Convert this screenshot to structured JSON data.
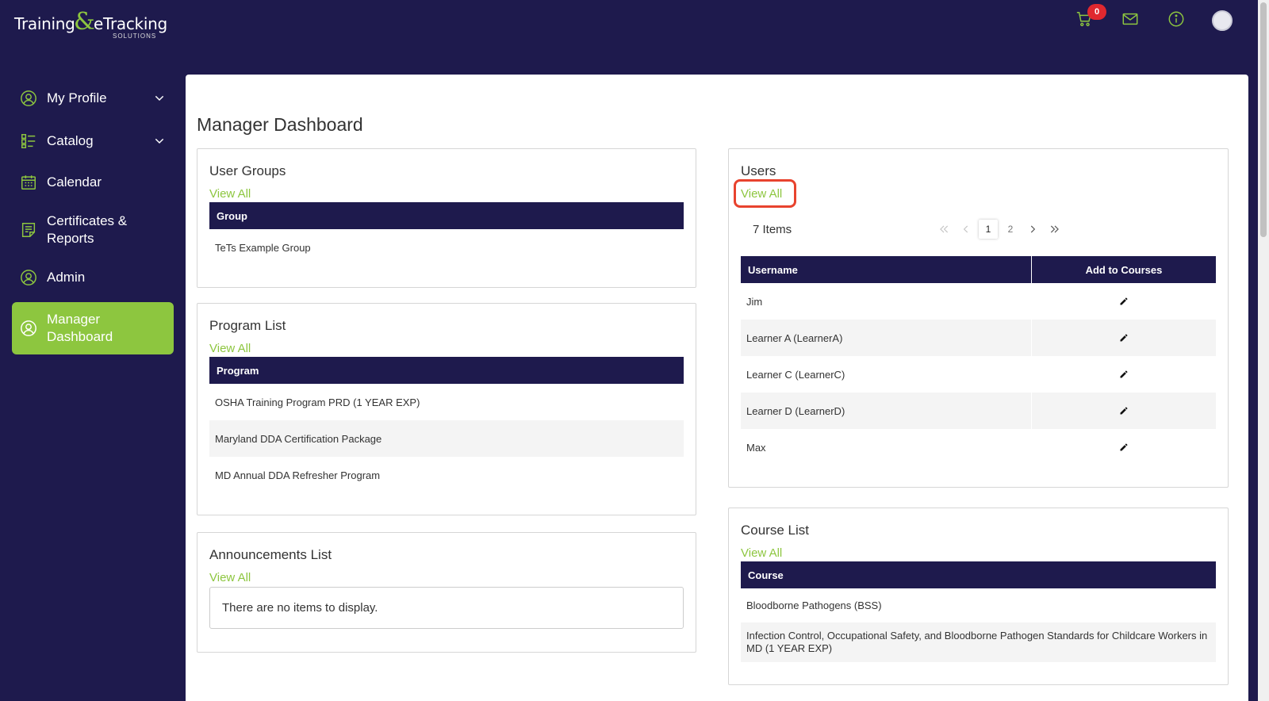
{
  "app": {
    "logo_word1": "Training",
    "logo_amp": "&",
    "logo_word2": "eTracking",
    "logo_sub": "SOLUTIONS"
  },
  "header": {
    "cart_count": "0",
    "icons": [
      "cart-icon",
      "mail-icon",
      "info-icon",
      "avatar"
    ]
  },
  "sidebar": {
    "items": [
      {
        "label": "My Profile",
        "icon": "user-circle-icon",
        "expandable": true
      },
      {
        "label": "Catalog",
        "icon": "list-icon",
        "expandable": true
      },
      {
        "label": "Calendar",
        "icon": "calendar-icon",
        "expandable": false
      },
      {
        "label": "Certificates &",
        "label2": "Reports",
        "icon": "report-icon",
        "expandable": false
      },
      {
        "label": "Admin",
        "icon": "user-circle-icon",
        "expandable": false
      },
      {
        "label": "Manager",
        "label2": "Dashboard",
        "icon": "user-circle-icon",
        "expandable": false,
        "active": true
      }
    ]
  },
  "main": {
    "title": "Manager Dashboard",
    "user_groups": {
      "title": "User Groups",
      "view_all": "View All",
      "header": "Group",
      "rows": [
        "TeTs Example Group"
      ]
    },
    "program_list": {
      "title": "Program List",
      "view_all": "View All",
      "header": "Program",
      "rows": [
        "OSHA Training Program PRD (1 YEAR EXP)",
        "Maryland DDA Certification Package",
        "MD Annual DDA Refresher Program"
      ]
    },
    "announcements": {
      "title": "Announcements List",
      "view_all": "View All",
      "empty": "There are no items to display."
    },
    "users": {
      "title": "Users",
      "view_all": "View All",
      "items_count": "7 Items",
      "pages": [
        "1",
        "2"
      ],
      "current_page": "1",
      "col_username": "Username",
      "col_add": "Add to Courses",
      "rows": [
        "Jim",
        "Learner A (LearnerA)",
        "Learner C (LearnerC)",
        "Learner D (LearnerD)",
        "Max"
      ]
    },
    "course_list": {
      "title": "Course List",
      "view_all": "View All",
      "header": "Course",
      "rows": [
        "Bloodborne Pathogens (BSS)",
        "Infection Control, Occupational Safety, and Bloodborne Pathogen Standards for Childcare Workers in MD (1 YEAR EXP)"
      ]
    }
  },
  "colors": {
    "navy": "#1e1a4d",
    "green": "#8dc63f",
    "highlight_red": "#e8432e",
    "badge_red": "#e0282f"
  }
}
